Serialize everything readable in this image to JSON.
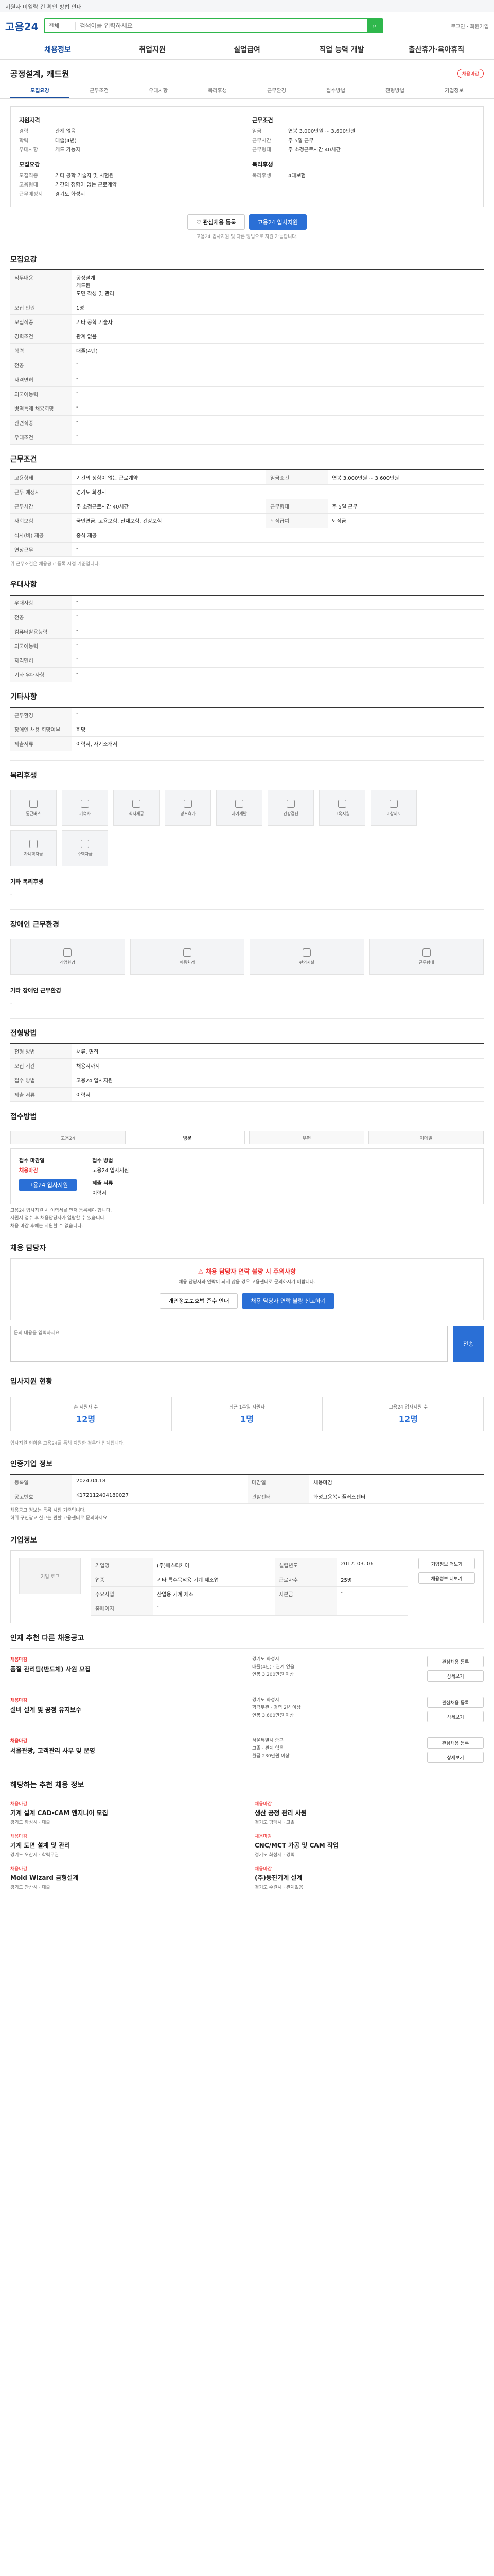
{
  "notice": "지원자 미열람 건 확인 방법 안내",
  "header": {
    "logo": "고용24",
    "search_scope": "전체",
    "search_placeholder": "검색어를 입력하세요",
    "links": "로그인 · 회원가입"
  },
  "gnb": [
    "채용정보",
    "취업지원",
    "실업급여",
    "직업 능력 개발",
    "출산휴가·육아휴직"
  ],
  "job": {
    "title": "공정설계, 캐드원",
    "status": "채용마감",
    "tabs": [
      "모집요강",
      "근무조건",
      "우대사항",
      "복리후생",
      "근무환경",
      "접수방법",
      "전형방법",
      "기업정보"
    ]
  },
  "summary": {
    "left_title": "지원자격",
    "left": [
      {
        "k": "경력",
        "v": "관계 없음"
      },
      {
        "k": "학력",
        "v": "대졸(4년)"
      },
      {
        "k": "우대사항",
        "v": "캐드 가능자"
      }
    ],
    "left_title2": "모집요강",
    "left2": [
      {
        "k": "모집직종",
        "v": "기타 공학 기술자 및 시험원"
      },
      {
        "k": "고용형태",
        "v": "기간의 정함이 없는 근로계약"
      },
      {
        "k": "근무예정지",
        "v": "경기도 화성시"
      }
    ],
    "right_title": "근무조건",
    "right": [
      {
        "k": "임금",
        "v": "연봉 3,000만원 ~ 3,600만원"
      },
      {
        "k": "근무시간",
        "v": "주 5일 근무"
      },
      {
        "k": "근무형태",
        "v": "주 소정근로시간 40시간"
      }
    ],
    "right_title2": "복리후생",
    "right2": [
      {
        "k": "복리후생",
        "v": "4대보험"
      }
    ],
    "btn_save": "관심채용 등록",
    "btn_apply": "고용24 입사지원",
    "note": "고용24 입사지원 및 다른 방법으로 지원 가능합니다."
  },
  "recruit": {
    "title": "모집요강",
    "subsec": "직무내용",
    "job_desc": "공정설계",
    "job_lines": [
      "공정설계",
      "캐드원",
      "도면 작성 및 관리"
    ],
    "rows": [
      {
        "k": "모집 인원",
        "v": "1명"
      },
      {
        "k": "모집직종",
        "v": "기타 공학 기술자"
      },
      {
        "k": "경력조건",
        "v": "관계 없음"
      },
      {
        "k": "학력",
        "v": "대졸(4년)"
      },
      {
        "k": "전공",
        "v": "-"
      },
      {
        "k": "자격면허",
        "v": "-"
      },
      {
        "k": "외국어능력",
        "v": "-"
      }
    ],
    "rows_right": [
      {
        "k": "병역특례 채용희망",
        "v": "-"
      },
      {
        "k": "관련직종",
        "v": "-"
      },
      {
        "k": "우대조건",
        "v": "-"
      }
    ]
  },
  "conditions": {
    "title": "근무조건",
    "rows": [
      {
        "k": "고용형태",
        "v": "기간의 정함이 없는 근로계약",
        "k2": "임금조건",
        "v2": "연봉 3,000만원 ~ 3,600만원"
      },
      {
        "k": "근무 예정지",
        "v": "경기도 화성시",
        "k2": "",
        "v2": ""
      },
      {
        "k": "근무시간",
        "v": "주 소정근로시간 40시간",
        "k2": "근무형태",
        "v2": "주 5일 근무"
      },
      {
        "k": "사회보험",
        "v": "국민연금, 고용보험, 산재보험, 건강보험",
        "k2": "퇴직급여",
        "v2": "퇴직금"
      },
      {
        "k": "식사(비) 제공",
        "v": "중식 제공",
        "k2": "",
        "v2": ""
      },
      {
        "k": "연장근무",
        "v": "-",
        "k2": "",
        "v2": ""
      }
    ],
    "footnote": "위 근무조건은 채용공고 등록 시점 기준입니다."
  },
  "prefer": {
    "title": "우대사항",
    "rows": [
      {
        "k": "우대사항",
        "v": "-"
      },
      {
        "k": "전공",
        "v": "-"
      },
      {
        "k": "컴퓨터활용능력",
        "v": "-"
      },
      {
        "k": "외국어능력",
        "v": "-"
      },
      {
        "k": "자격면허",
        "v": "-"
      },
      {
        "k": "기타 우대사항",
        "v": "-"
      }
    ]
  },
  "extra": {
    "title": "기타사항",
    "rows": [
      {
        "k": "근무환경",
        "v": "-"
      },
      {
        "k": "장애인 채용 희망여부",
        "v": "희망"
      },
      {
        "k": "제출서류",
        "v": "이력서, 자기소개서"
      }
    ]
  },
  "welfare": {
    "title": "복리후생",
    "cards": [
      "통근버스",
      "기숙사",
      "식사제공",
      "경조휴가",
      "자기계발",
      "건강검진",
      "교육지원",
      "포상제도",
      "자녀학자금",
      "주택자금"
    ],
    "subsec": "기타 복리후생",
    "etc": "-"
  },
  "env": {
    "title": "장애인 근무환경",
    "cards": [
      "작업환경",
      "이동환경",
      "편의시설",
      "근무형태"
    ],
    "subsec": "기타 장애인 근무환경",
    "etc": "-"
  },
  "selection": {
    "title": "전형방법",
    "rows": [
      {
        "k": "전형 방법",
        "v": "서류, 면접"
      },
      {
        "k": "모집 기간",
        "v": "채용시까지"
      },
      {
        "k": "접수 방법",
        "v": "고용24 입사지원"
      },
      {
        "k": "제출 서류",
        "v": "이력서"
      }
    ]
  },
  "apply": {
    "title": "접수방법",
    "tabs": [
      "고용24",
      "방문",
      "우편",
      "이메일"
    ],
    "col1_title": "접수 마감일",
    "col1_value": "채용마감",
    "col1_btn": "고용24 입사지원",
    "col2_title": "접수 방법",
    "col2_value": "고용24 입사지원",
    "col3_title": "제출 서류",
    "col3_value": "이력서",
    "notes": [
      "고용24 입사지원 시 이력서를 먼저 등록해야 합니다.",
      "지원서 접수 후 채용담당자가 열람할 수 있습니다.",
      "채용 마감 후에는 지원할 수 없습니다."
    ]
  },
  "inquiry": {
    "title": "채용 담당자",
    "warn_title": "채용 담당자 연락 불량 시 주의사항",
    "warn_text": "채용 담당자와 연락이 되지 않을 경우 고용센터로 문의하시기 바랍니다.",
    "btn1": "개인정보보호법 준수 안내",
    "btn2": "채용 담당자 연락 불량 신고하기",
    "placeholder": "문의 내용을 입력하세요",
    "send": "전송"
  },
  "stats": {
    "title": "입사지원 현황",
    "cards": [
      {
        "lbl": "총 지원자 수",
        "num": "12명"
      },
      {
        "lbl": "최근 1주일 지원자",
        "num": "1명"
      },
      {
        "lbl": "고용24 입사지원 수",
        "num": "12명"
      }
    ],
    "note": "입사지원 현황은 고용24를 통해 지원한 경우만 집계됩니다."
  },
  "history": {
    "title": "인증기업 정보",
    "rows": [
      {
        "k": "등록일",
        "v": "2024.04.18",
        "k2": "마감일",
        "v2": "채용마감"
      },
      {
        "k": "공고번호",
        "v": "K172112404180027",
        "k2": "관할센터",
        "v2": "화성고용복지플러스센터"
      }
    ],
    "notes": [
      "채용공고 정보는 등록 시점 기준입니다.",
      "허위 구인광고 신고는 관할 고용센터로 문의하세요."
    ]
  },
  "company": {
    "title": "기업정보",
    "logo": "기업 로고",
    "rows": [
      {
        "k": "기업명",
        "v": "(주)에스티케이",
        "k2": "설립년도",
        "v2": "2017. 03. 06"
      },
      {
        "k": "업종",
        "v": "기타 특수목적용 기계 제조업",
        "k2": "근로자수",
        "v2": "25명"
      },
      {
        "k": "주요사업",
        "v": "산업용 기계 제조",
        "k2": "자본금",
        "v2": "-"
      },
      {
        "k": "홈페이지",
        "v": "-",
        "k2": "",
        "v2": ""
      }
    ],
    "btn1": "기업정보 더보기",
    "btn2": "채용정보 더보기"
  },
  "recommend": {
    "title": "인재 추천 다른 채용공고",
    "items": [
      {
        "cat": "채용마감",
        "ttl": "품질 관리팀(반도체) 사원 모집",
        "mid": [
          "경기도 화성시",
          "대졸(4년) · 관계 없음",
          "연봉 3,200만원 이상"
        ],
        "b1": "관심채용 등록",
        "b2": "상세보기"
      },
      {
        "cat": "채용마감",
        "ttl": "설비 설계 및 공정 유지보수",
        "mid": [
          "경기도 화성시",
          "학력무관 · 경력 2년 이상",
          "연봉 3,600만원 이상"
        ],
        "b1": "관심채용 등록",
        "b2": "상세보기"
      },
      {
        "cat": "채용마감",
        "ttl": "서울관광, 고객관리 사무 및 운영",
        "mid": [
          "서울특별시 중구",
          "고졸 · 관계 없음",
          "월급 230만원 이상"
        ],
        "b1": "관심채용 등록",
        "b2": "상세보기"
      }
    ]
  },
  "more": {
    "title": "해당하는 추천 채용 정보",
    "items": [
      {
        "cat": "채용마감",
        "ttl": "기계 설계 CAD·CAM 엔지니어 모집",
        "meta": "경기도 화성시 · 대졸"
      },
      {
        "cat": "채용마감",
        "ttl": "생산 공정 관리 사원",
        "meta": "경기도 평택시 · 고졸"
      },
      {
        "cat": "채용마감",
        "ttl": "기계 도면 설계 및 관리",
        "meta": "경기도 오산시 · 학력무관"
      },
      {
        "cat": "채용마감",
        "ttl": "CNC/MCT 가공 및 CAM 작업",
        "meta": "경기도 화성시 · 경력"
      },
      {
        "cat": "채용마감",
        "ttl": "Mold Wizard 금형설계",
        "meta": "경기도 안산시 · 대졸"
      },
      {
        "cat": "채용마감",
        "ttl": "(주)동진기계 설계",
        "meta": "경기도 수원시 · 관계없음"
      }
    ]
  }
}
